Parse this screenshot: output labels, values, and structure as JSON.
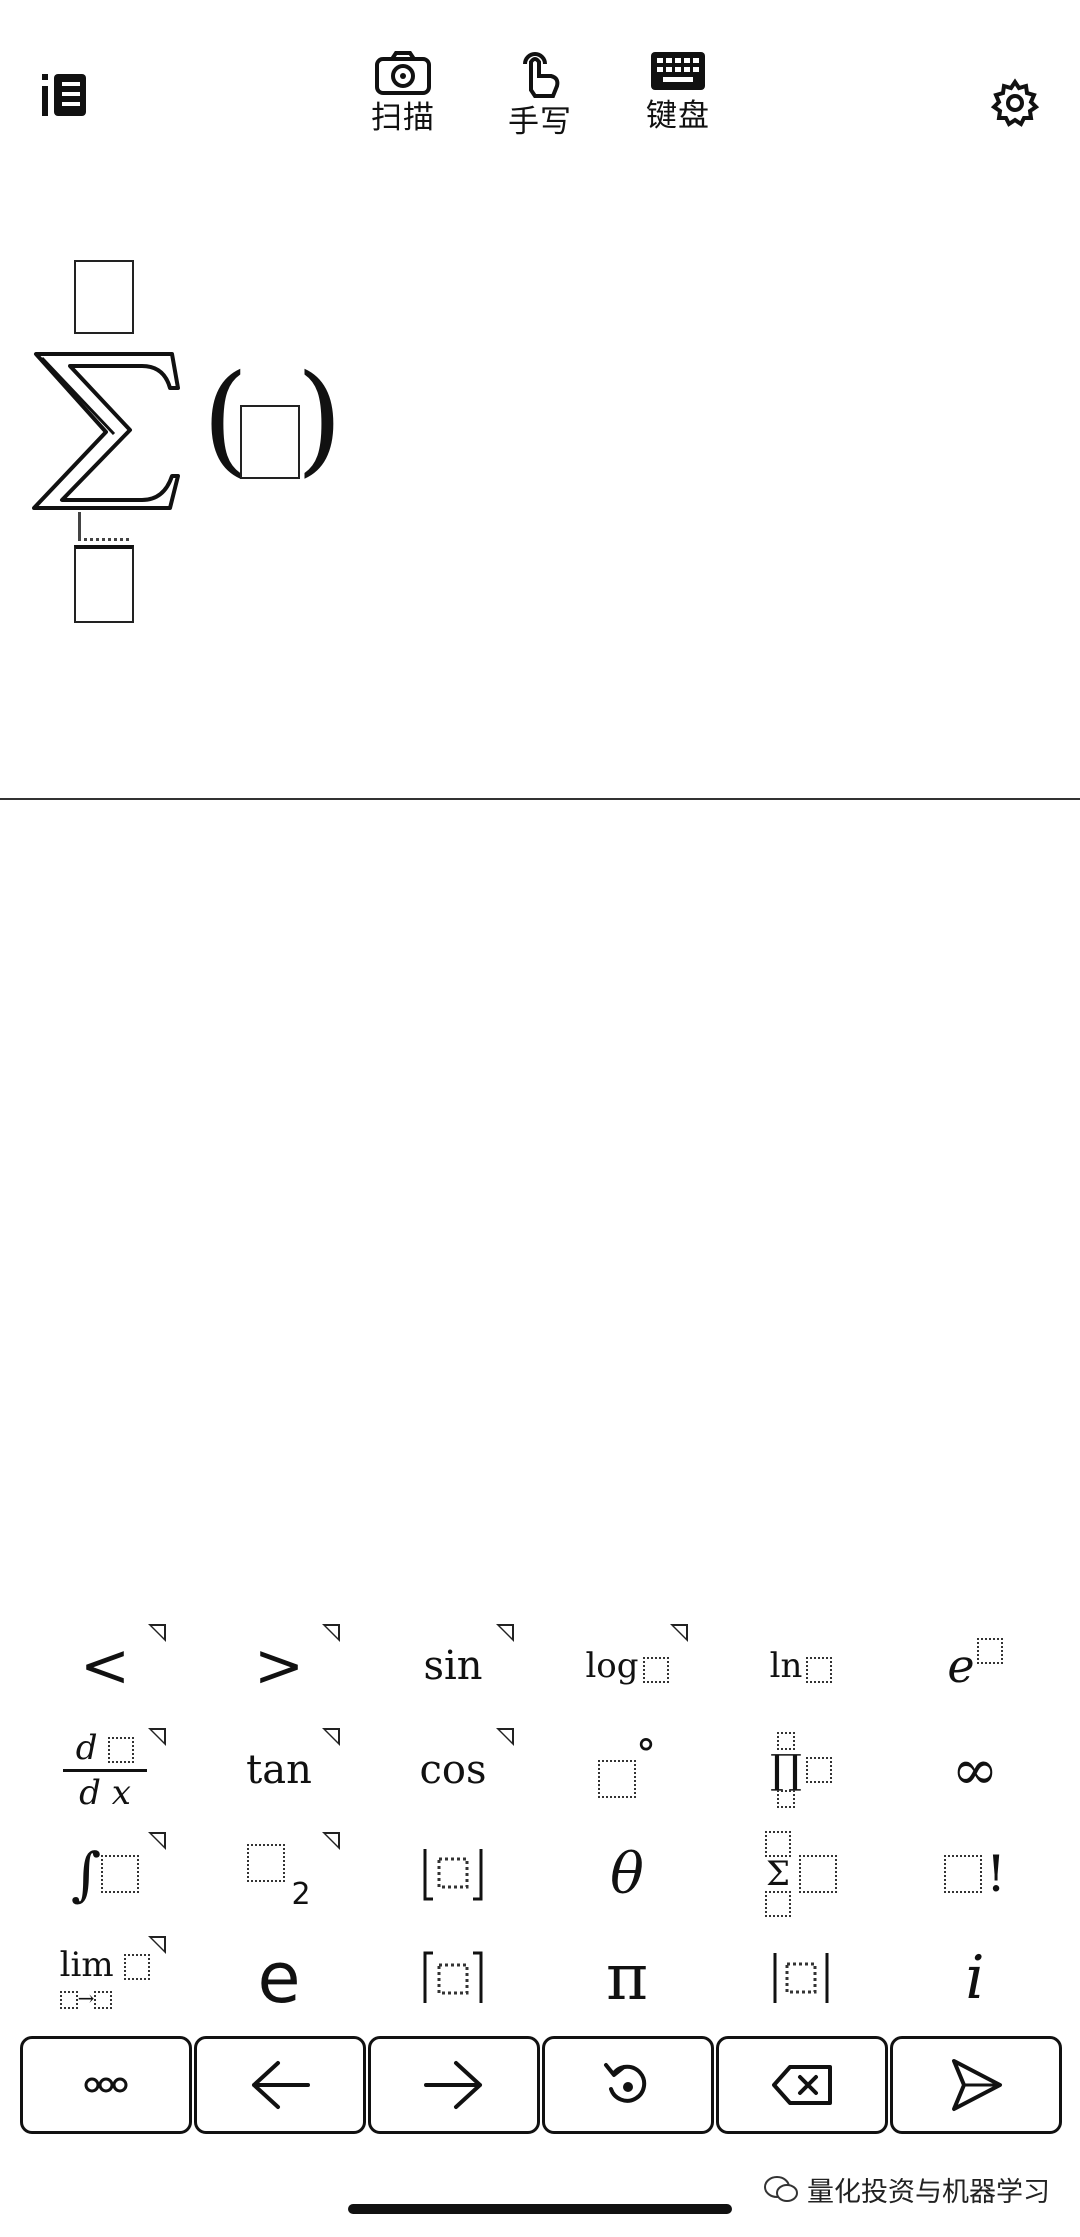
{
  "toolbar": {
    "scan_label": "扫描",
    "handwrite_label": "手写",
    "keyboard_label": "键盘"
  },
  "editor": {
    "open_paren": "(",
    "close_paren": ")"
  },
  "keypad": {
    "row1": {
      "less": "<",
      "greater": ">",
      "sin": "sin",
      "log": "log",
      "ln": "ln",
      "e": "e"
    },
    "row2": {
      "d": "d",
      "dx": "d x",
      "tan": "tan",
      "cos": "cos",
      "degree": "°",
      "prod": "∏",
      "infinity": "∞"
    },
    "row3": {
      "integral": "∫",
      "subscript": "2",
      "theta": "θ",
      "sum": "Σ",
      "factorial": "!"
    },
    "row4": {
      "lim": "lim",
      "arrow": "→",
      "euler": "e",
      "pi": "π",
      "imag": "i"
    }
  },
  "watermark": {
    "text": "量化投资与机器学习"
  }
}
